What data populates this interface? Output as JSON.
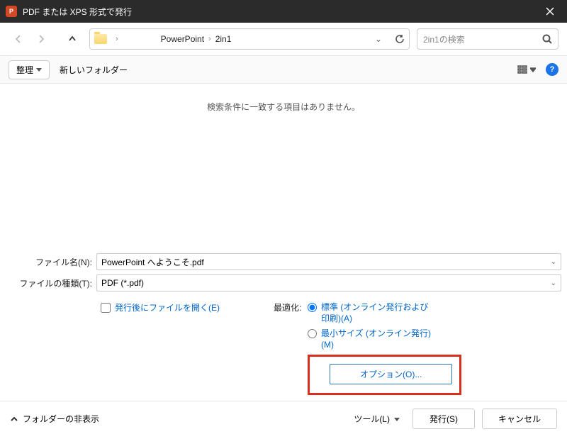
{
  "window": {
    "title": "PDF または XPS 形式で発行"
  },
  "nav": {
    "breadcrumb": [
      "PowerPoint",
      "2in1"
    ],
    "search_placeholder": "2in1の検索"
  },
  "toolbar": {
    "organize": "整理",
    "new_folder": "新しいフォルダー"
  },
  "file_area": {
    "empty_message": "検索条件に一致する項目はありません。"
  },
  "form": {
    "filename_label": "ファイル名(N):",
    "filename_value": "PowerPoint へようこそ.pdf",
    "filetype_label": "ファイルの種類(T):",
    "filetype_value": "PDF (*.pdf)",
    "open_after_label": "発行後にファイルを開く(E)",
    "open_after_checked": false,
    "optimize_label": "最適化:",
    "optimize_options": [
      {
        "label": "標準 (オンライン発行および印刷)(A)",
        "selected": true
      },
      {
        "label": "最小サイズ (オンライン発行)(M)",
        "selected": false
      }
    ],
    "options_button": "オプション(O)..."
  },
  "footer": {
    "hide_folders": "フォルダーの非表示",
    "tools": "ツール(L)",
    "publish": "発行(S)",
    "cancel": "キャンセル"
  }
}
